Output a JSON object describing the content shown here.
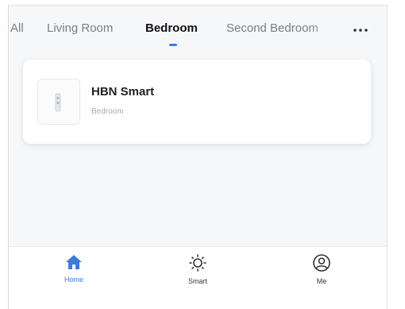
{
  "tabs": {
    "items": [
      {
        "label": "All",
        "active": false
      },
      {
        "label": "Living Room",
        "active": false
      },
      {
        "label": "Bedroom",
        "active": true
      },
      {
        "label": "Second Bedroom",
        "active": false
      }
    ],
    "more_icon": "ellipsis-icon"
  },
  "device_card": {
    "name": "HBN Smart",
    "room": "Bedroom",
    "thumbnail_icon": "smart-plug-icon"
  },
  "bottom_nav": {
    "items": [
      {
        "label": "Home",
        "icon": "home-icon",
        "active": true
      },
      {
        "label": "Smart",
        "icon": "sun-icon",
        "active": false
      },
      {
        "label": "Me",
        "icon": "user-icon",
        "active": false
      }
    ]
  },
  "colors": {
    "accent": "#3b7ae0",
    "background": "#f6f7f9",
    "card": "#ffffff",
    "text_primary": "#111111",
    "text_secondary": "#7a7e87"
  }
}
